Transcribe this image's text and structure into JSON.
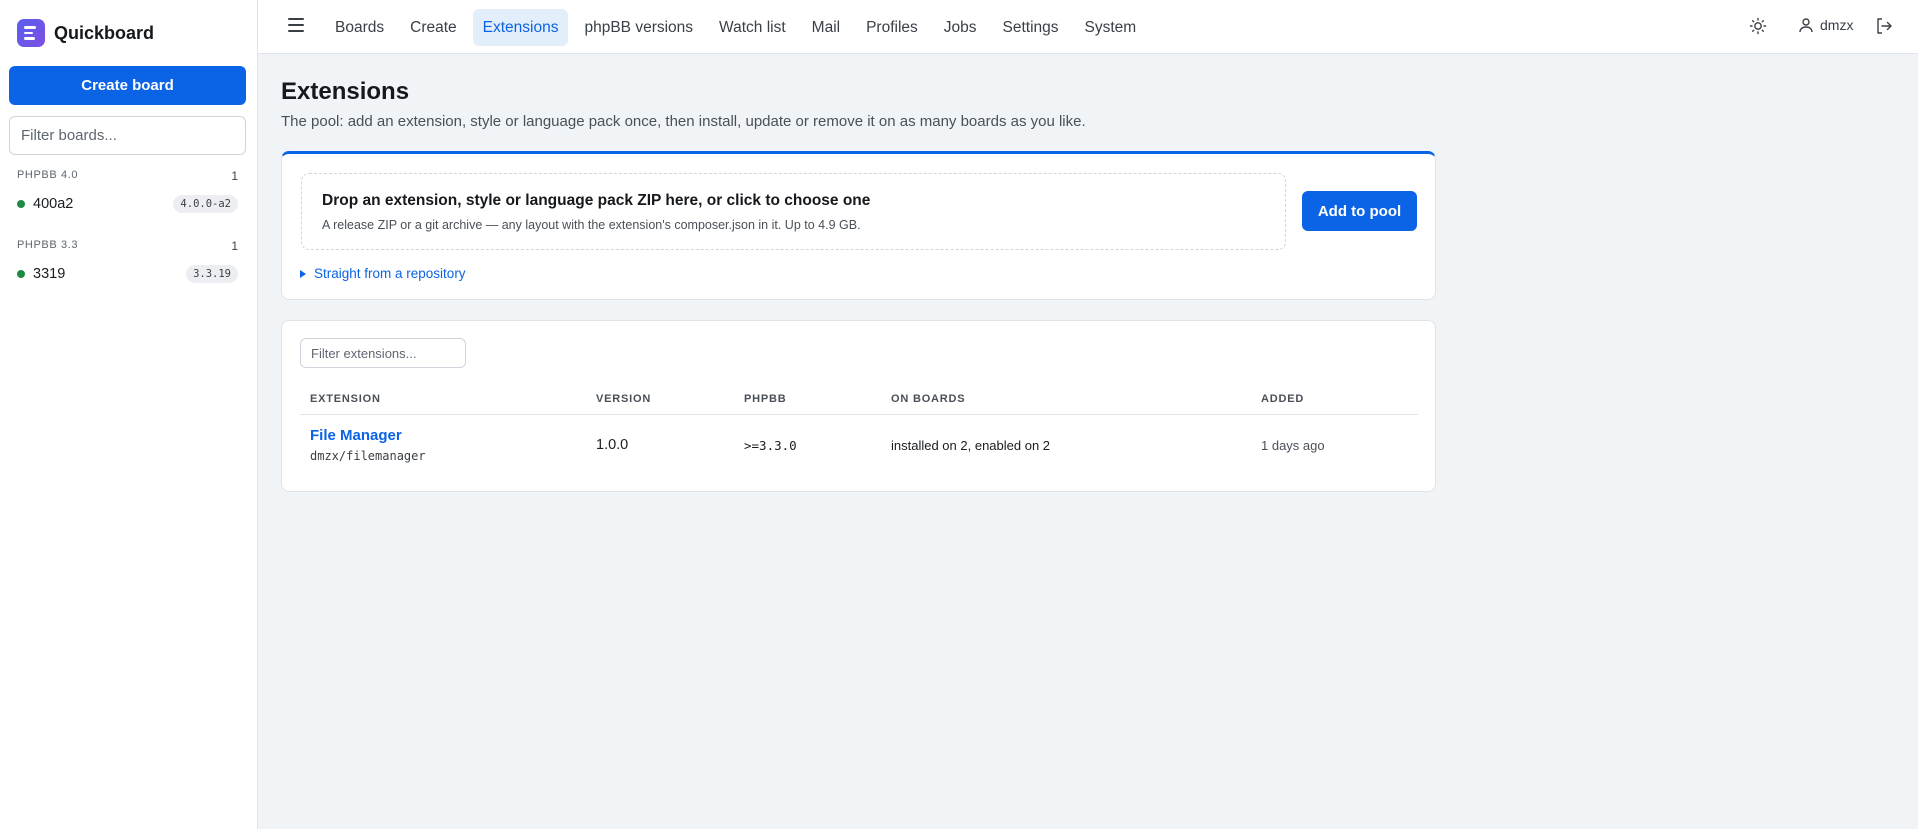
{
  "app": {
    "name": "Quickboard"
  },
  "sidebar": {
    "create_label": "Create board",
    "filter_placeholder": "Filter boards...",
    "groups": [
      {
        "label": "PHPBB 4.0",
        "count": "1",
        "boards": [
          {
            "name": "400a2",
            "badge": "4.0.0-a2",
            "status_color": "#1f8a46"
          }
        ]
      },
      {
        "label": "PHPBB 3.3",
        "count": "1",
        "boards": [
          {
            "name": "3319",
            "badge": "3.3.19",
            "status_color": "#1f8a46"
          }
        ]
      }
    ]
  },
  "topbar": {
    "nav": [
      "Boards",
      "Create",
      "Extensions",
      "phpBB versions",
      "Watch list",
      "Mail",
      "Profiles",
      "Jobs",
      "Settings",
      "System"
    ],
    "active": "Extensions",
    "user": "dmzx"
  },
  "page": {
    "title": "Extensions",
    "subtitle": "The pool: add an extension, style or language pack once, then install, update or remove it on as many boards as you like."
  },
  "upload": {
    "drop_title": "Drop an extension, style or language pack ZIP here, or click to choose one",
    "drop_sub": "A release ZIP or a git archive — any layout with the extension's composer.json in it. Up to 4.9 GB.",
    "add_label": "Add to pool",
    "repo_label": "Straight from a repository"
  },
  "extensions": {
    "filter_placeholder": "Filter extensions...",
    "columns": [
      "EXTENSION",
      "VERSION",
      "PHPBB",
      "ON BOARDS",
      "ADDED"
    ],
    "rows": [
      {
        "name": "File Manager",
        "id": "dmzx/filemanager",
        "version": "1.0.0",
        "phpbb": ">=3.3.0",
        "on_boards": "installed on 2, enabled on 2",
        "added": "1 days ago"
      }
    ]
  },
  "colors": {
    "accent": "#0b63e5",
    "status_ok": "#1f8a46",
    "page_bg": "#f1f4f7"
  },
  "icons": {
    "menu": "hamburger-icon",
    "theme": "sun-icon",
    "user": "user-icon",
    "logout": "logout-icon"
  }
}
